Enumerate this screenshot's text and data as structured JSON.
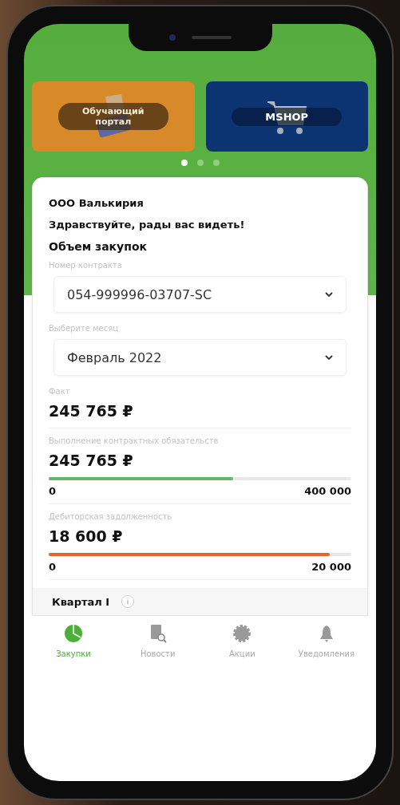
{
  "banners": [
    {
      "kind": "training",
      "title": "Обучающий портал"
    },
    {
      "kind": "shop",
      "title": "MSHOP"
    }
  ],
  "pager": [
    {
      "selected": true
    },
    {
      "selected": false
    },
    {
      "selected": false
    }
  ],
  "company": "ООО Валькирия",
  "greeting": "Здравствуйте, рады вас видеть!",
  "section_title": "Объем закупок",
  "selects": [
    {
      "label": "Номер контракта",
      "value": "054-999996-03707-SC"
    },
    {
      "label": "Выберите месяц",
      "value": "Февраль 2022"
    }
  ],
  "metrics": [
    {
      "kind": "plain",
      "label": "Факт",
      "value": "245 765 ₽"
    },
    {
      "kind": "progress",
      "label": "Выполнение контрактных обязательств",
      "value": "245 765 ₽",
      "level": 0.61,
      "color": "#5fb86a",
      "min": "0",
      "max": "400 000"
    },
    {
      "kind": "progress",
      "label": "Дебиторская задолженность",
      "value": "18 600 ₽",
      "level": 0.93,
      "color": "#e0662a",
      "min": "0",
      "max": "20 000"
    }
  ],
  "quarter": {
    "title": "Квартал I"
  },
  "nav": [
    {
      "kind": "purchases",
      "label": "Закупки",
      "selected": true
    },
    {
      "kind": "news",
      "label": "Новости",
      "selected": false
    },
    {
      "kind": "promo",
      "label": "Акции",
      "selected": false
    },
    {
      "kind": "alerts",
      "label": "Уведомления",
      "selected": false
    }
  ]
}
